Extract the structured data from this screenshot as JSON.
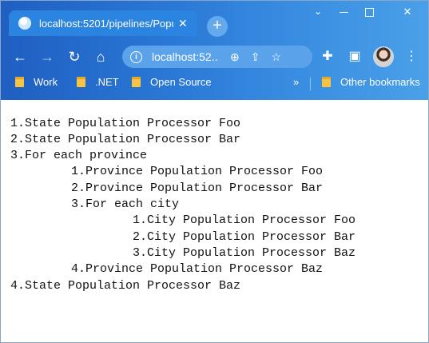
{
  "tab": {
    "title": "localhost:5201/pipelines/Popu",
    "close_icon": "close-icon"
  },
  "toolbar": {
    "url": "localhost:52..."
  },
  "bookmarks": [
    {
      "label": "Work"
    },
    {
      "label": ".NET"
    },
    {
      "label": "Open Source"
    }
  ],
  "bookmarks_more": "»",
  "bookmarks_other": "Other bookmarks",
  "content": {
    "lines": [
      {
        "text": "1.State Population Processor Foo",
        "indent": 0
      },
      {
        "text": "2.State Population Processor Bar",
        "indent": 0
      },
      {
        "text": "3.For each province",
        "indent": 0
      },
      {
        "text": "1.Province Population Processor Foo",
        "indent": 1
      },
      {
        "text": "2.Province Population Processor Bar",
        "indent": 1
      },
      {
        "text": "3.For each city",
        "indent": 1
      },
      {
        "text": "1.City Population Processor Foo",
        "indent": 2
      },
      {
        "text": "2.City Population Processor Bar",
        "indent": 2
      },
      {
        "text": "3.City Population Processor Baz",
        "indent": 2
      },
      {
        "text": "4.Province Population Processor Baz",
        "indent": 1
      },
      {
        "text": "4.State Population Processor Baz",
        "indent": 0
      }
    ]
  },
  "colors": {
    "chrome_start": "#1f5fc2",
    "chrome_end": "#4aa0e8",
    "text": "#111111"
  }
}
